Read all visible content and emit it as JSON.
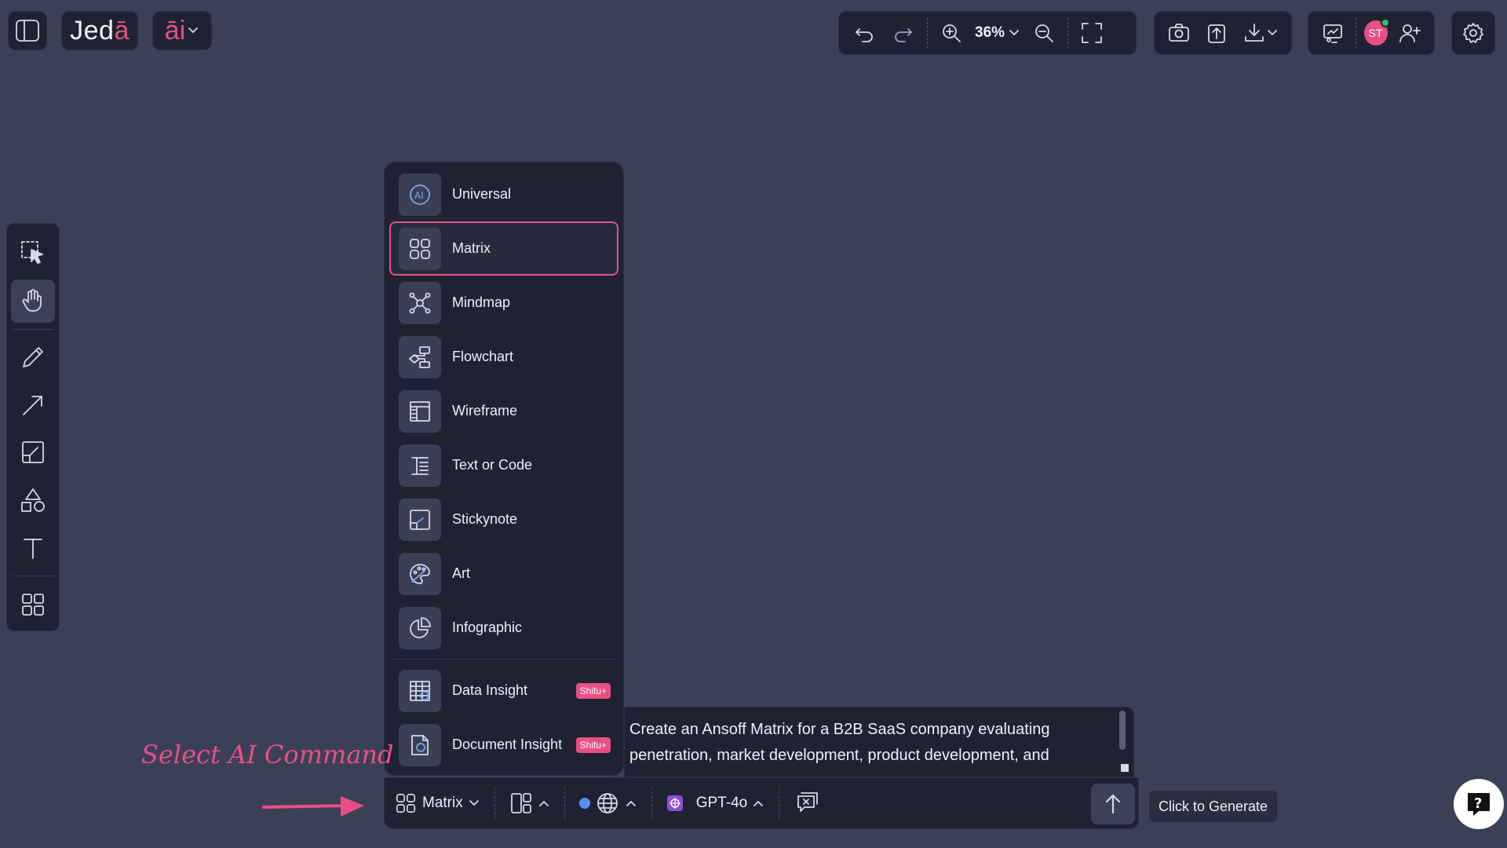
{
  "app": {
    "logo_text": "Jed",
    "logo_accent": "ā",
    "ai_label": "āi"
  },
  "toolbar": {
    "zoom": "36%"
  },
  "user": {
    "initials": "ST"
  },
  "menu": {
    "items": [
      {
        "label": "Universal",
        "icon": "ai-circle-icon"
      },
      {
        "label": "Matrix",
        "icon": "matrix-icon",
        "selected": true
      },
      {
        "label": "Mindmap",
        "icon": "mindmap-icon"
      },
      {
        "label": "Flowchart",
        "icon": "flowchart-icon"
      },
      {
        "label": "Wireframe",
        "icon": "wireframe-icon"
      },
      {
        "label": "Text or Code",
        "icon": "text-icon"
      },
      {
        "label": "Stickynote",
        "icon": "stickynote-icon"
      },
      {
        "label": "Art",
        "icon": "palette-icon"
      },
      {
        "label": "Infographic",
        "icon": "pie-icon"
      }
    ],
    "premium_items": [
      {
        "label": "Data Insight",
        "icon": "data-grid-icon",
        "badge": "Shifu+"
      },
      {
        "label": "Document Insight",
        "icon": "document-icon",
        "badge": "Shifu+"
      }
    ]
  },
  "prompt": {
    "line1": "Create an Ansoff Matrix for a B2B SaaS company evaluating",
    "line2": "penetration, market development, product development, and"
  },
  "bottom_bar": {
    "command": "Matrix",
    "model": "GPT-4o"
  },
  "tooltip": "Click to Generate",
  "annotation": "Select AI Command",
  "colors": {
    "accent": "#e84f86",
    "background": "#3b4057",
    "panel": "#1f2233"
  }
}
